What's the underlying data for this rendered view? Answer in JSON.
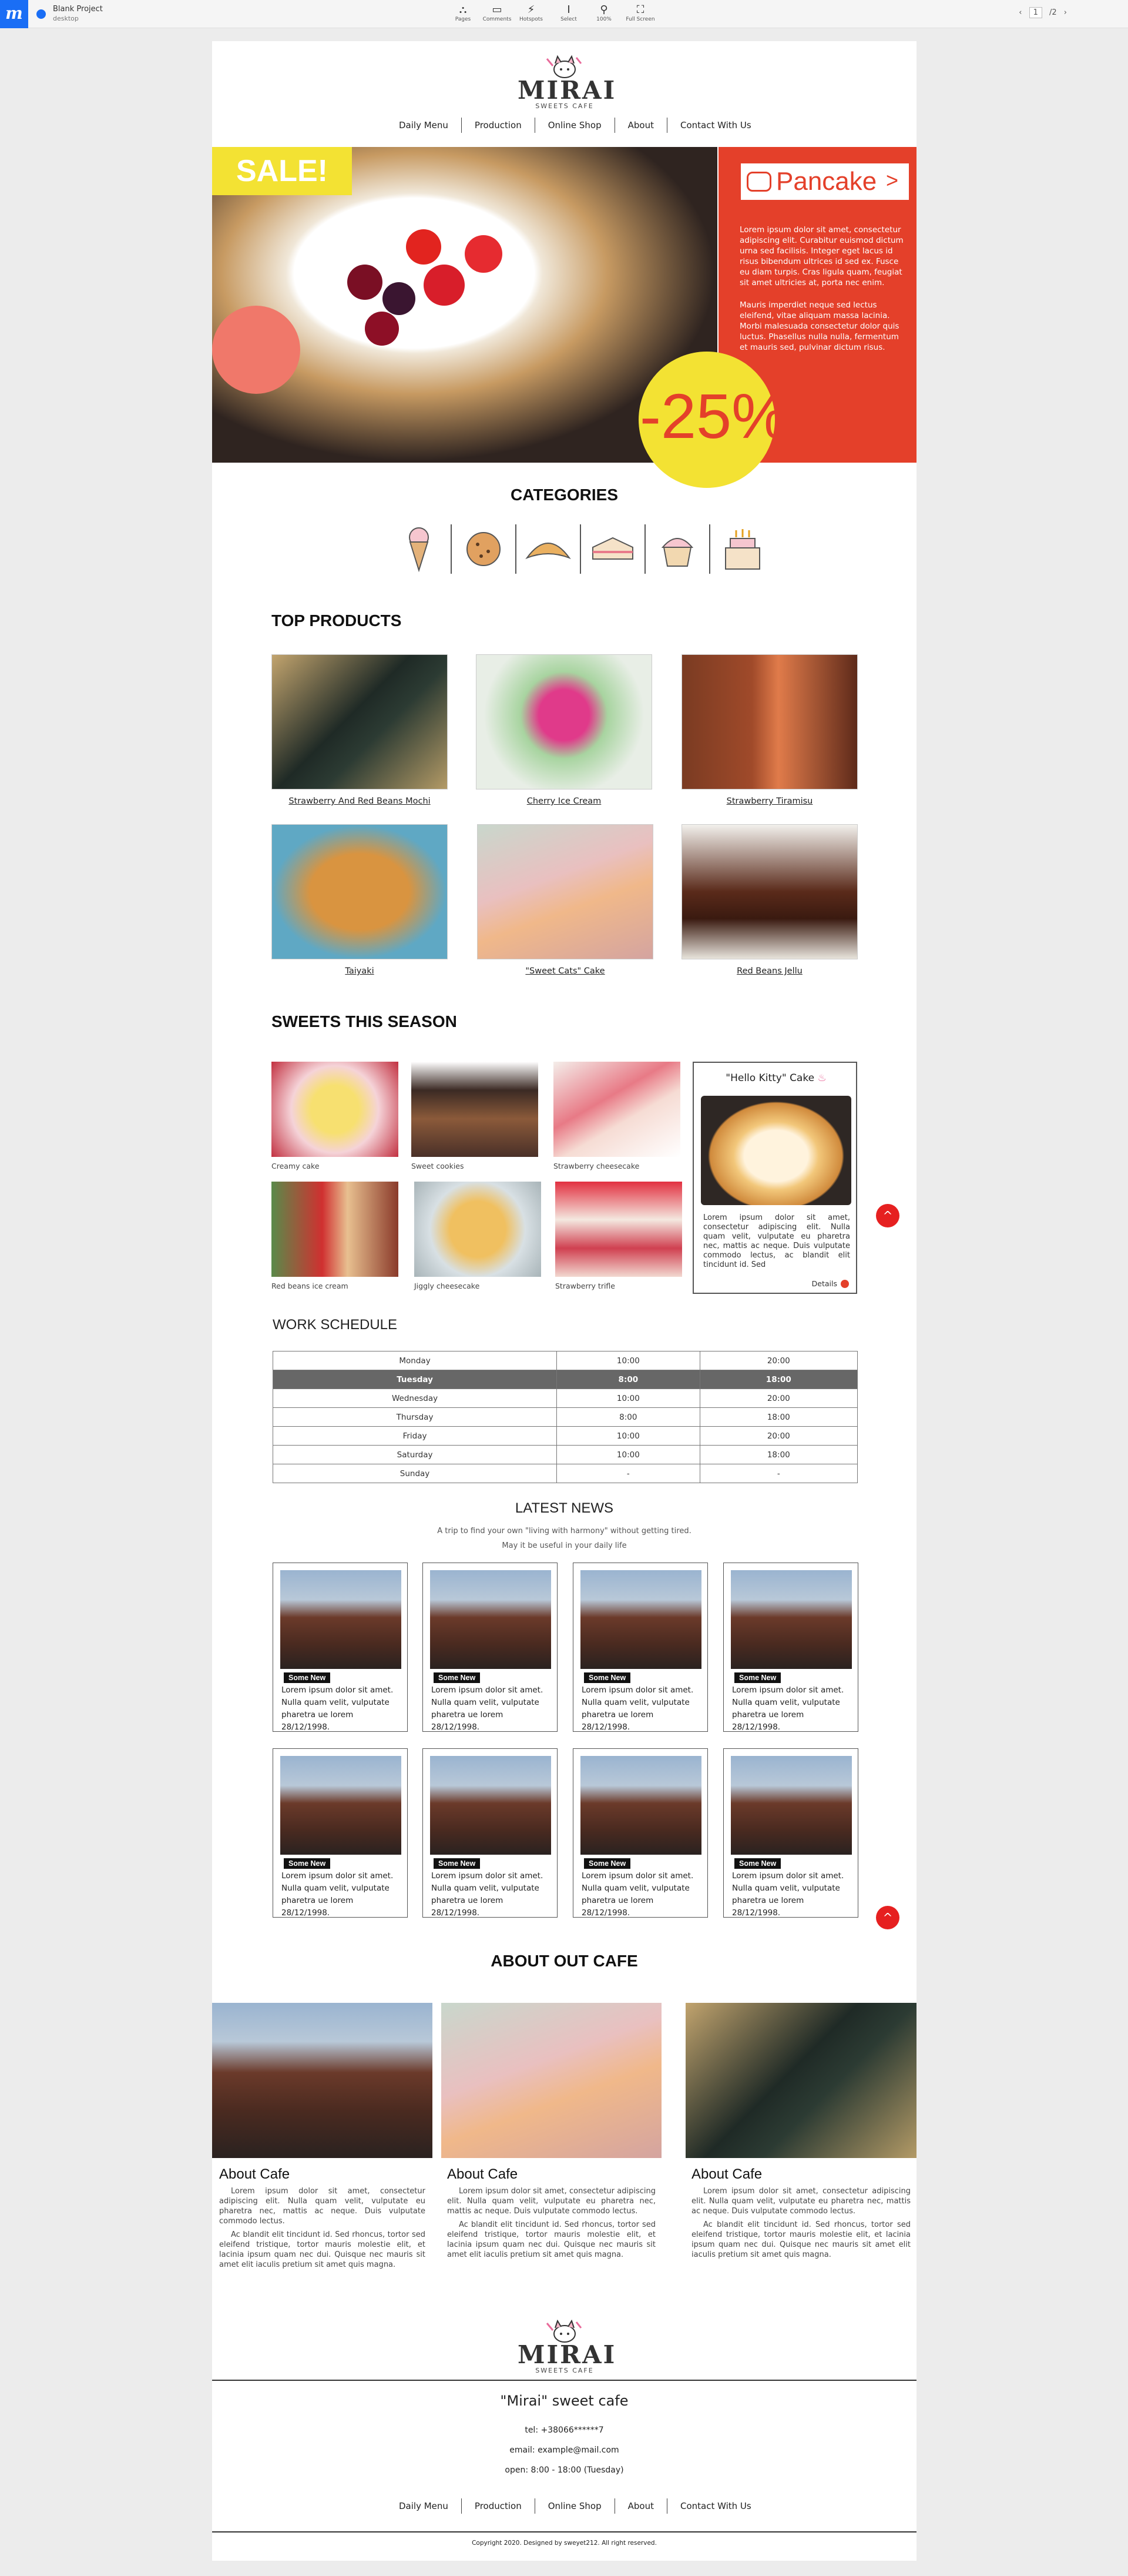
{
  "topbar": {
    "project_name": "Blank Project",
    "project_sub": "desktop",
    "tools": [
      {
        "label": "Pages",
        "icon": "pages-icon"
      },
      {
        "label": "Comments",
        "icon": "comments-icon"
      },
      {
        "label": "Hotspots",
        "icon": "hotspots-icon"
      },
      {
        "label": "Select",
        "icon": "select-icon"
      },
      {
        "label": "100%",
        "icon": "zoom-icon"
      },
      {
        "label": "Full Screen",
        "icon": "fullscreen-icon"
      }
    ],
    "page_current": "1",
    "page_total": "/2"
  },
  "logo": {
    "word": "MIRAI",
    "sub": "SWEETS CAFE"
  },
  "nav": [
    "Daily Menu",
    "Production",
    "Online Shop",
    "About",
    "Contact With Us"
  ],
  "hero": {
    "sale": "SALE!",
    "button": "Pancake",
    "button_arrow": ">",
    "p1": "Lorem ipsum dolor sit amet, consectetur adipiscing elit. Curabitur euismod dictum urna sed facilisis. Integer eget lacus id risus bibendum ultrices id sed ex. Fusce eu diam turpis. Cras ligula quam, feugiat sit amet ultricies at, porta nec enim.",
    "p2": "Mauris imperdiet neque sed lectus eleifend, vitae aliquam massa lacinia. Morbi malesuada consectetur dolor quis luctus. Phasellus nulla nulla, fermentum et mauris sed, pulvinar dictum risus.",
    "discount": "-25%"
  },
  "categories": {
    "title": "CATEGORIES",
    "items": [
      "ice-cream-icon",
      "cookie-icon",
      "croissant-icon",
      "cake-slice-icon",
      "cupcake-icon",
      "birthday-cake-icon"
    ]
  },
  "top_products": {
    "title": "TOP PRODUCTS",
    "items": [
      "Strawberry And Red Beans Mochi",
      "Cherry Ice Cream",
      "Strawberry Tiramisu",
      "Taiyaki",
      "\"Sweet Cats\" Cake",
      "Red Beans Jellu"
    ]
  },
  "season": {
    "title": "SWEETS THIS SEASON",
    "items": [
      "Creamy cake",
      "Sweet cookies",
      "Strawberry cheesecake",
      "Red beans ice cream",
      "Jiggly cheesecake",
      "Strawberry trifle"
    ],
    "featured": {
      "title": "\"Hello Kitty\" Cake",
      "text": "Lorem ipsum dolor sit amet, consectetur adipiscing elit. Nulla quam velit, vulputate eu pharetra nec, mattis ac neque. Duis vulputate commodo lectus, ac blandit elit tincidunt id. Sed",
      "details": "Details"
    },
    "up": "^"
  },
  "schedule": {
    "title": "WORK SCHEDULE",
    "rows": [
      [
        "Monday",
        "10:00",
        "20:00"
      ],
      [
        "Tuesday",
        "8:00",
        "18:00"
      ],
      [
        "Wednesday",
        "10:00",
        "20:00"
      ],
      [
        "Thursday",
        "8:00",
        "18:00"
      ],
      [
        "Friday",
        "10:00",
        "20:00"
      ],
      [
        "Saturday",
        "10:00",
        "18:00"
      ],
      [
        "Sunday",
        "-",
        "-"
      ]
    ]
  },
  "news": {
    "title": "LATEST NEWS",
    "sub1": "A trip to find your own \"living with harmony\" without getting tired.",
    "sub2": "May it be useful in your daily life",
    "tag": "Some New",
    "text": "Lorem ipsum dolor sit amet. Nulla quam velit, vulputate pharetra ue lorem 28/12/1998.",
    "up": "^"
  },
  "about": {
    "title": "ABOUT OUT CAFE",
    "heading": "About Cafe",
    "p1": "Lorem ipsum dolor sit amet, consectetur adipiscing elit. Nulla quam velit, vulputate eu pharetra nec, mattis ac neque. Duis vulputate commodo lectus.",
    "p2": "Ac blandit elit tincidunt id. Sed rhoncus, tortor sed eleifend tristique, tortor mauris molestie elit, et lacinia ipsum quam nec dui. Quisque nec mauris sit amet elit iaculis pretium sit amet quis magna."
  },
  "footer": {
    "name": "\"Mirai\" sweet cafe",
    "tel": "tel: +38066******7",
    "email": "email: example@mail.com",
    "open": "open: 8:00 - 18:00 (Tuesday)",
    "copyright": "Copyright 2020. Designed by sweyet212. All right reserved."
  },
  "colors": {
    "accent": "#e4402a",
    "yellow": "#f3e233",
    "blue": "#1a6ef5"
  }
}
